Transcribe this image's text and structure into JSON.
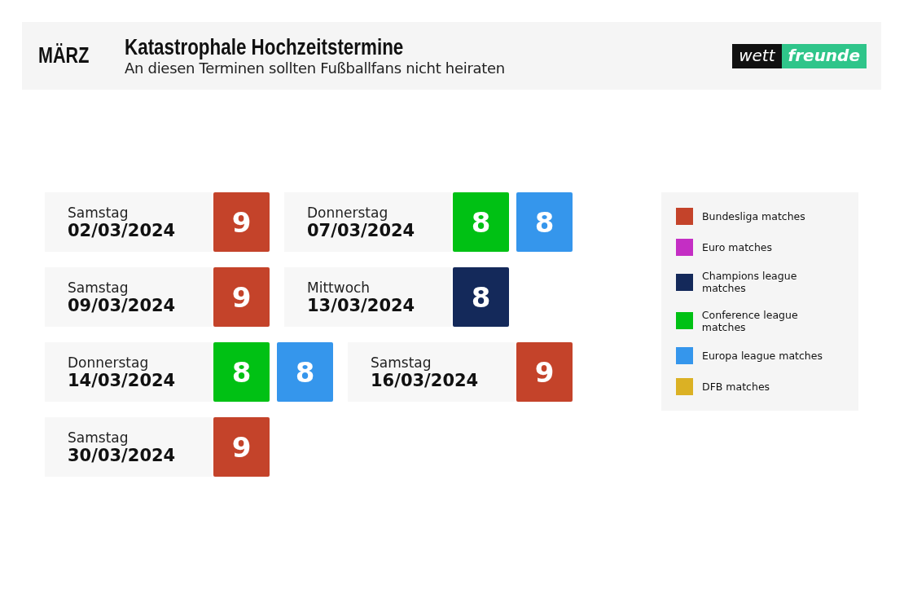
{
  "header": {
    "month": "MÄRZ",
    "title": "Katastrophale Hochzeitstermine",
    "subtitle": "An diesen Terminen sollten Fußballfans nicht heiraten",
    "logo": [
      "wett",
      "freunde"
    ]
  },
  "rows": [
    [
      {
        "day": "Samstag",
        "date": "02/03/2024",
        "badges": [
          {
            "count": "9",
            "color": "#c4432a"
          }
        ]
      },
      {
        "day": "Donnerstag",
        "date": "07/03/2024",
        "badges": [
          {
            "count": "8",
            "color": "#00c114"
          },
          {
            "count": "8",
            "color": "#3596ec"
          }
        ]
      }
    ],
    [
      {
        "day": "Samstag",
        "date": "09/03/2024",
        "badges": [
          {
            "count": "9",
            "color": "#c4432a"
          }
        ]
      },
      {
        "day": "Mittwoch",
        "date": "13/03/2024",
        "badges": [
          {
            "count": "8",
            "color": "#14295a"
          }
        ]
      }
    ],
    [
      {
        "day": "Donnerstag",
        "date": "14/03/2024",
        "badges": [
          {
            "count": "8",
            "color": "#00c114"
          },
          {
            "count": "8",
            "color": "#3596ec"
          }
        ]
      },
      {
        "day": "Samstag",
        "date": "16/03/2024",
        "badges": [
          {
            "count": "9",
            "color": "#c4432a"
          }
        ]
      }
    ],
    [
      {
        "day": "Samstag",
        "date": "30/03/2024",
        "badges": [
          {
            "count": "9",
            "color": "#c4432a"
          }
        ]
      }
    ]
  ],
  "legend": [
    {
      "label": "Bundesliga matches",
      "color": "#c4432a"
    },
    {
      "label": "Euro matches",
      "color": "#c42ec4"
    },
    {
      "label": "Champions league matches",
      "color": "#14295a"
    },
    {
      "label": "Conference league matches",
      "color": "#00c114"
    },
    {
      "label": "Europa league matches",
      "color": "#3596ec"
    },
    {
      "label": "DFB matches",
      "color": "#dbb124"
    }
  ]
}
